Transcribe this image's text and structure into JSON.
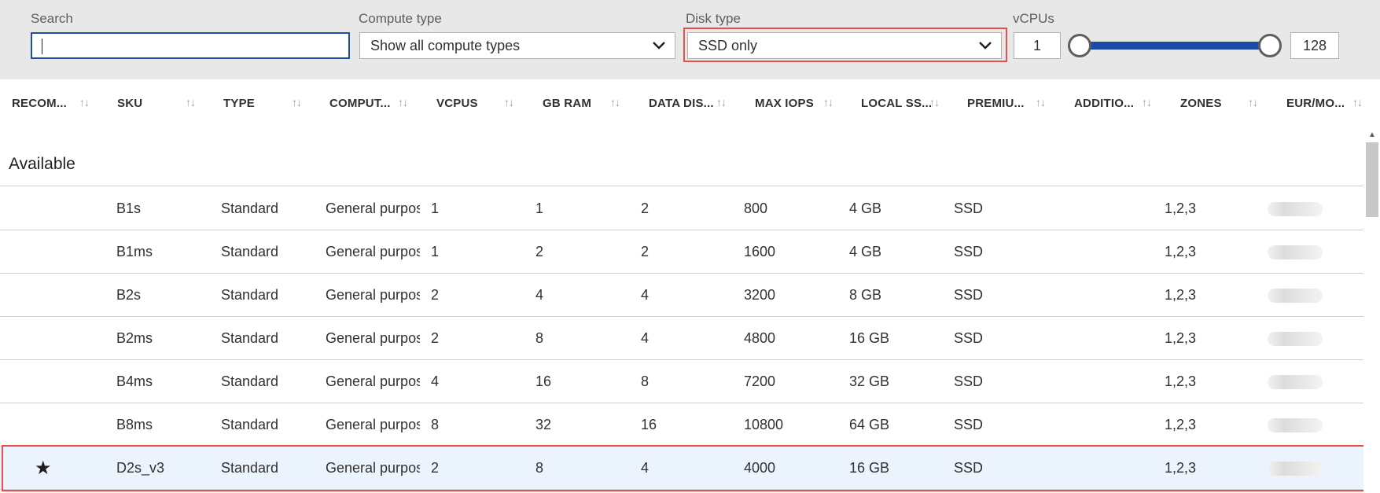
{
  "filters": {
    "search": {
      "label": "Search",
      "value": "",
      "placeholder": ""
    },
    "compute_type": {
      "label": "Compute type",
      "selected": "Show all compute types"
    },
    "disk_type": {
      "label": "Disk type",
      "selected": "SSD only"
    },
    "vcpus": {
      "label": "vCPUs",
      "min": "1",
      "max": "128"
    }
  },
  "columns": [
    "RECOM...",
    "SKU",
    "TYPE",
    "COMPUT...",
    "VCPUS",
    "GB RAM",
    "DATA DIS...",
    "MAX IOPS",
    "LOCAL SS...",
    "PREMIU...",
    "ADDITIO...",
    "ZONES",
    "EUR/MO..."
  ],
  "group": {
    "title": "Available"
  },
  "rows": [
    {
      "recommended": "",
      "sku": "B1s",
      "type": "Standard",
      "compute": "General purpose",
      "vcpus": "1",
      "gb_ram": "1",
      "data_disks": "2",
      "max_iops": "800",
      "local_ssd": "4 GB",
      "premium": "SSD",
      "additional": "",
      "zones": "1,2,3"
    },
    {
      "recommended": "",
      "sku": "B1ms",
      "type": "Standard",
      "compute": "General purpose",
      "vcpus": "1",
      "gb_ram": "2",
      "data_disks": "2",
      "max_iops": "1600",
      "local_ssd": "4 GB",
      "premium": "SSD",
      "additional": "",
      "zones": "1,2,3"
    },
    {
      "recommended": "",
      "sku": "B2s",
      "type": "Standard",
      "compute": "General purpose",
      "vcpus": "2",
      "gb_ram": "4",
      "data_disks": "4",
      "max_iops": "3200",
      "local_ssd": "8 GB",
      "premium": "SSD",
      "additional": "",
      "zones": "1,2,3"
    },
    {
      "recommended": "",
      "sku": "B2ms",
      "type": "Standard",
      "compute": "General purpose",
      "vcpus": "2",
      "gb_ram": "8",
      "data_disks": "4",
      "max_iops": "4800",
      "local_ssd": "16 GB",
      "premium": "SSD",
      "additional": "",
      "zones": "1,2,3"
    },
    {
      "recommended": "",
      "sku": "B4ms",
      "type": "Standard",
      "compute": "General purpose",
      "vcpus": "4",
      "gb_ram": "16",
      "data_disks": "8",
      "max_iops": "7200",
      "local_ssd": "32 GB",
      "premium": "SSD",
      "additional": "",
      "zones": "1,2,3"
    },
    {
      "recommended": "",
      "sku": "B8ms",
      "type": "Standard",
      "compute": "General purpose",
      "vcpus": "8",
      "gb_ram": "32",
      "data_disks": "16",
      "max_iops": "10800",
      "local_ssd": "64 GB",
      "premium": "SSD",
      "additional": "",
      "zones": "1,2,3"
    },
    {
      "recommended": "★",
      "sku": "D2s_v3",
      "type": "Standard",
      "compute": "General purpose",
      "vcpus": "2",
      "gb_ram": "8",
      "data_disks": "4",
      "max_iops": "4000",
      "local_ssd": "16 GB",
      "premium": "SSD",
      "additional": "",
      "zones": "1,2,3"
    }
  ],
  "selected_row": 6,
  "icons": {
    "sort": "sort-arrows-icon",
    "chevron": "chevron-down-icon",
    "star": "star-icon"
  },
  "colors": {
    "accent": "#1a49a6",
    "highlight": "#e8504a",
    "selected_row_bg": "#ebf3fc",
    "filter_bar_bg": "#e8e8e8"
  }
}
